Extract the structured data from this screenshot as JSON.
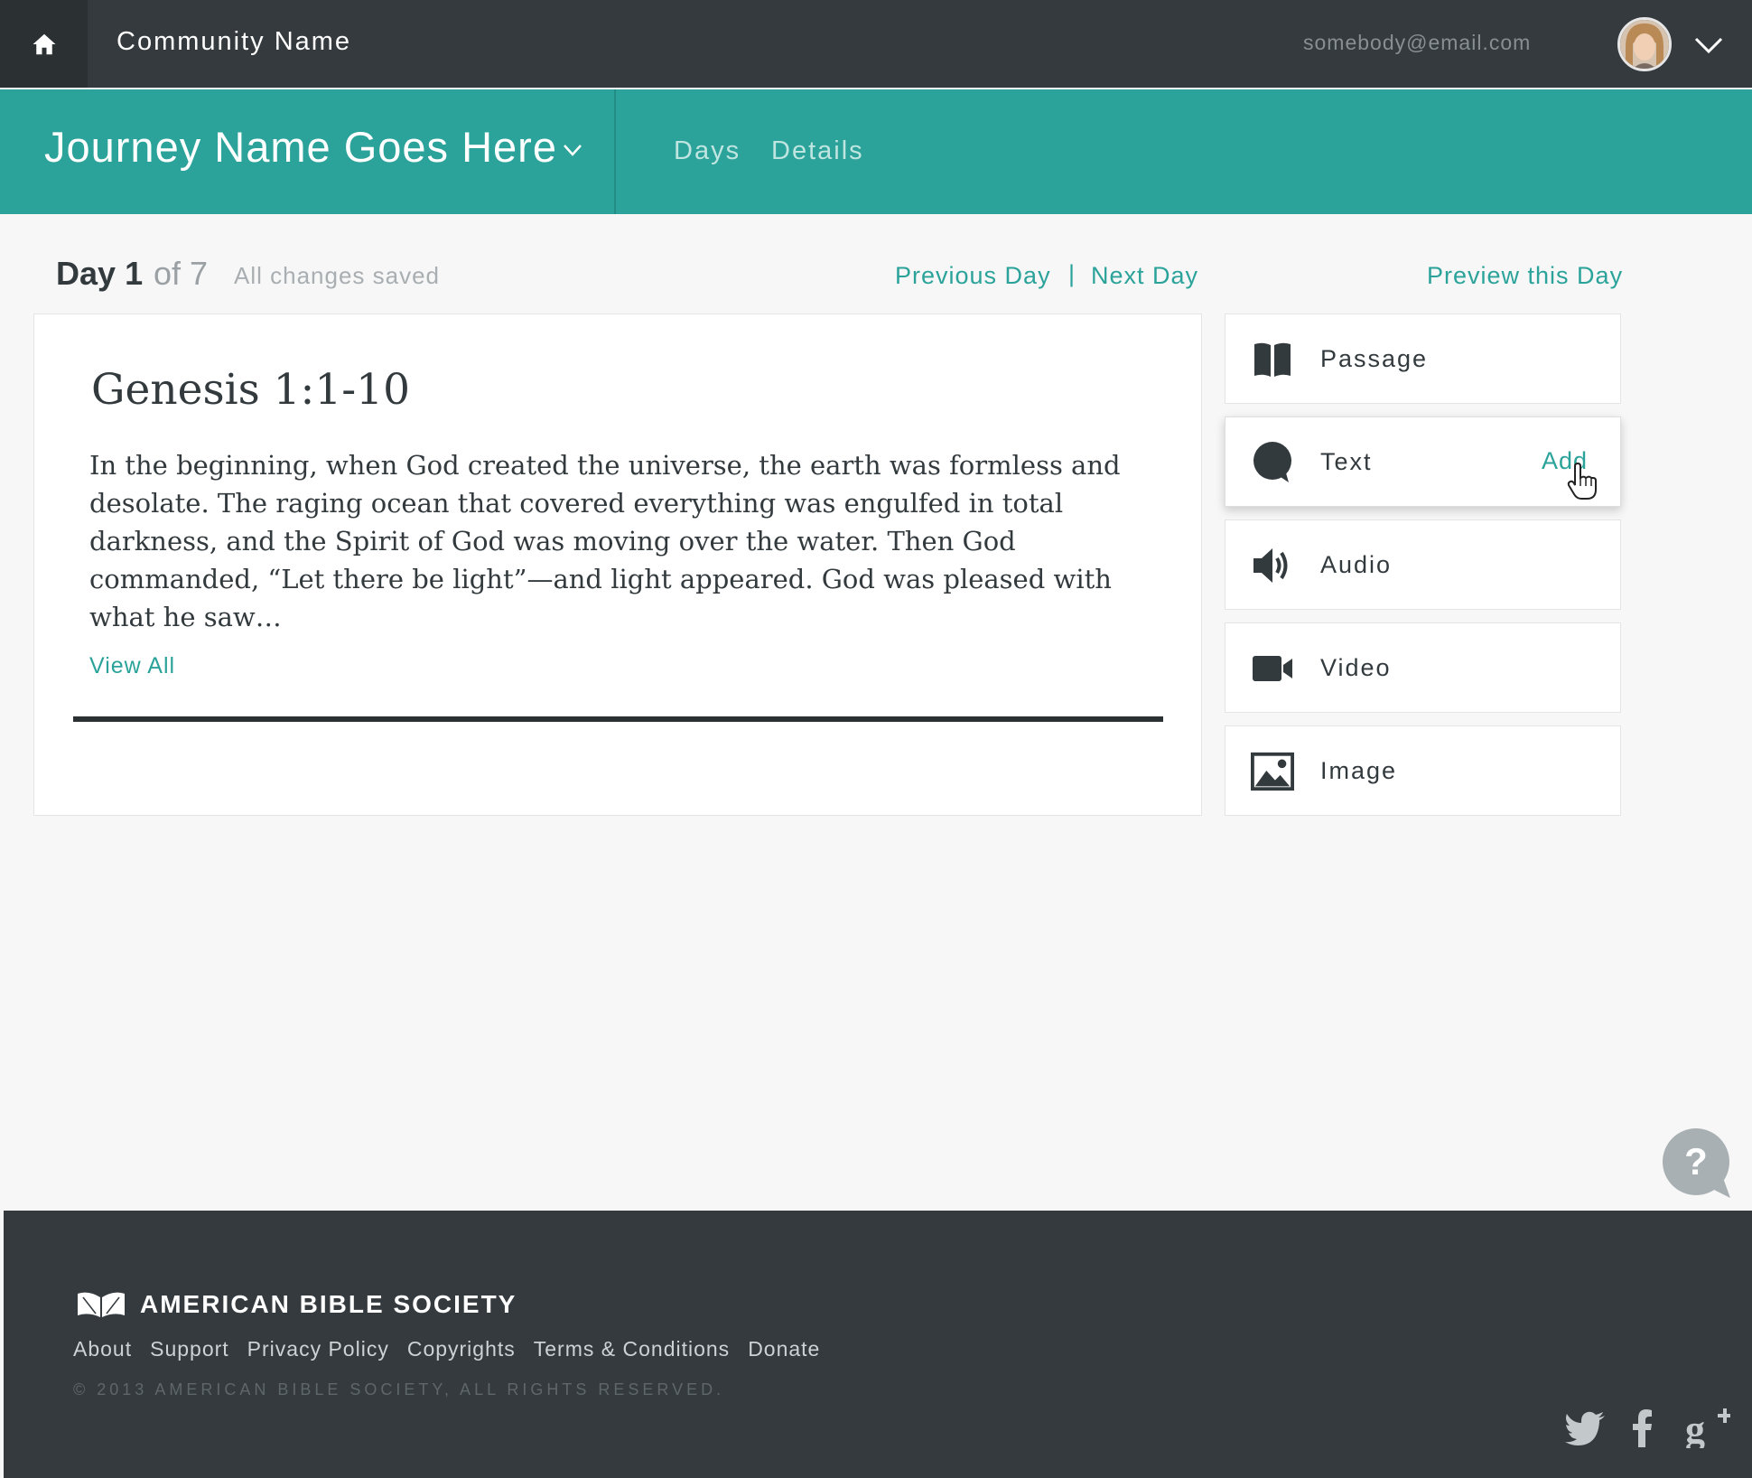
{
  "topbar": {
    "community_name": "Community Name",
    "user_email": "somebody@email.com",
    "home_icon": "home-icon",
    "menu_icon": "chevron-down-icon"
  },
  "journey": {
    "title": "Journey Name Goes Here",
    "tabs": [
      {
        "label": "Days"
      },
      {
        "label": "Details"
      }
    ]
  },
  "day": {
    "label": "Day",
    "number": "1",
    "of_total": "of 7",
    "status": "All changes saved",
    "prev_label": "Previous Day",
    "separator": "|",
    "next_label": "Next Day",
    "preview_label": "Preview this Day"
  },
  "passage": {
    "title": "Genesis 1:1-10",
    "body": "In the beginning, when God created the universe,  the earth was formless and desolate. The raging ocean that covered everything was engulfed in total darkness, and the Spirit of God  was moving over the water. Then God commanded, “Let there be light”—and light appeared. God was pleased with what he saw…",
    "view_all": "View All",
    "progress_fraction": 1.0
  },
  "content_types": [
    {
      "label": "Passage",
      "icon": "book-icon",
      "add": ""
    },
    {
      "label": "Text",
      "icon": "speech-bubble-icon",
      "add": "Add"
    },
    {
      "label": "Audio",
      "icon": "speaker-icon",
      "add": ""
    },
    {
      "label": "Video",
      "icon": "video-camera-icon",
      "add": ""
    },
    {
      "label": "Image",
      "icon": "image-icon",
      "add": ""
    }
  ],
  "footer": {
    "org_name": "AMERICAN BIBLE SOCIETY",
    "links": [
      "About",
      "Support",
      "Privacy Policy",
      "Copyrights",
      "Terms & Conditions",
      "Donate"
    ],
    "copyright": "© 2013 AMERICAN BIBLE SOCIETY, ALL RIGHTS RESERVED."
  },
  "colors": {
    "accent": "#2ba39a",
    "dark": "#343a3e",
    "background": "#f7f7f7"
  }
}
